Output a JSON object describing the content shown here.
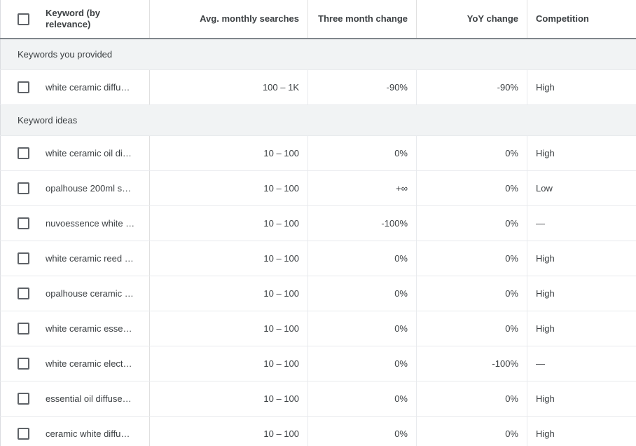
{
  "table": {
    "columns": [
      {
        "id": "keyword",
        "label": "Keyword (by relevance)",
        "align": "left"
      },
      {
        "id": "avg",
        "label": "Avg. monthly searches",
        "align": "right"
      },
      {
        "id": "three",
        "label": "Three month change",
        "align": "right"
      },
      {
        "id": "yoy",
        "label": "YoY change",
        "align": "right"
      },
      {
        "id": "comp",
        "label": "Competition",
        "align": "left"
      }
    ],
    "select_all_checkbox": "select-all",
    "sections": [
      {
        "title": "Keywords you provided",
        "rows": [
          {
            "keyword": "white ceramic diffu…",
            "avg": "100 – 1K",
            "three": "-90%",
            "yoy": "-90%",
            "comp": "High"
          }
        ]
      },
      {
        "title": "Keyword ideas",
        "rows": [
          {
            "keyword": "white ceramic oil di…",
            "avg": "10 – 100",
            "three": "0%",
            "yoy": "0%",
            "comp": "High"
          },
          {
            "keyword": "opalhouse 200ml s…",
            "avg": "10 – 100",
            "three": "+∞",
            "yoy": "0%",
            "comp": "Low"
          },
          {
            "keyword": "nuvoessence white …",
            "avg": "10 – 100",
            "three": "-100%",
            "yoy": "0%",
            "comp": "—"
          },
          {
            "keyword": "white ceramic reed …",
            "avg": "10 – 100",
            "three": "0%",
            "yoy": "0%",
            "comp": "High"
          },
          {
            "keyword": "opalhouse ceramic …",
            "avg": "10 – 100",
            "three": "0%",
            "yoy": "0%",
            "comp": "High"
          },
          {
            "keyword": "white ceramic esse…",
            "avg": "10 – 100",
            "three": "0%",
            "yoy": "0%",
            "comp": "High"
          },
          {
            "keyword": "white ceramic elect…",
            "avg": "10 – 100",
            "three": "0%",
            "yoy": "-100%",
            "comp": "—"
          },
          {
            "keyword": "essential oil diffuse…",
            "avg": "10 – 100",
            "three": "0%",
            "yoy": "0%",
            "comp": "High"
          },
          {
            "keyword": "ceramic white diffu…",
            "avg": "10 – 100",
            "three": "0%",
            "yoy": "0%",
            "comp": "High"
          }
        ]
      }
    ]
  },
  "colors": {
    "text": "#3c4043",
    "section_bg": "#f1f3f4",
    "row_border": "#e8eaed",
    "header_underline": "#80868b"
  }
}
